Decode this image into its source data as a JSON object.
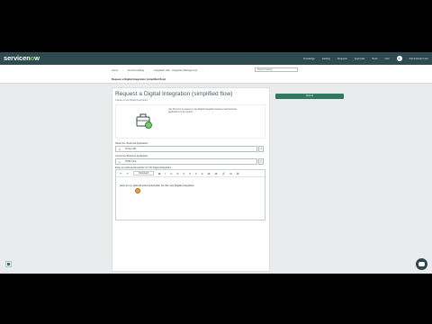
{
  "brand": {
    "name_prefix": "servicen",
    "name_o": "o",
    "name_suffix": "w"
  },
  "topnav": {
    "items": [
      "Knowledge",
      "Catalog",
      "Requests",
      "Approvals",
      "Tours",
      "Cart"
    ],
    "avatar_initial": "A",
    "user_name": "Administrator User"
  },
  "breadcrumbs": [
    "Home",
    "Service Catalog",
    "Integration Hub - Integration Management"
  ],
  "search": {
    "placeholder": "Search Catalog"
  },
  "page_title_small": "Request a Digital Integration (simplified flow)",
  "form": {
    "title": "Request a Digital Integration (simplified flow)",
    "subtitle": "Create a new Digital Integration",
    "hero_text": "Use this form to request a new Digital Integration between two business applications in the system.",
    "field1_label": "Select the Technical Application",
    "field1_value": "Vinsys HR",
    "field2_label": "Consumer Business Application",
    "field2_value": "ITSM Core",
    "field3_label": "Enter an optional description for this Digital Integration",
    "toolbar": {
      "undo": "↶",
      "redo": "↷",
      "paragraph": "Paragraph",
      "buttons": [
        "B",
        "I",
        "U",
        "S",
        "≡",
        "≡",
        "≡",
        "≡",
        "≔",
        "≔",
        "🔗",
        "⊞",
        "⌘"
      ]
    },
    "editor_text": "Here is my optional extra description for this new Digital Integration"
  },
  "submit_label": "Submit",
  "colors": {
    "nav": "#2e4a4f",
    "accent": "#62d84e",
    "submit": "#2e7a5f"
  },
  "icons": [
    "briefcase-icon",
    "chat-icon",
    "search-icon",
    "chevron-right-icon"
  ]
}
